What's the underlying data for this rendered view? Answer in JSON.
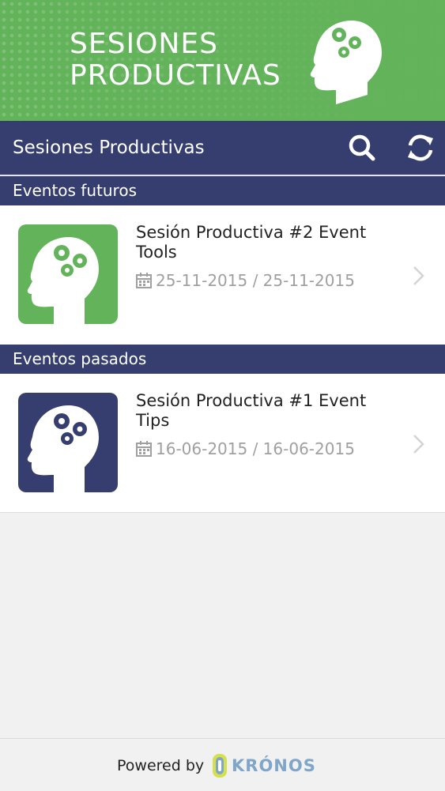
{
  "banner": {
    "line1": "SESIONES",
    "line2": "PRODUCTIVAS"
  },
  "toolbar": {
    "title": "Sesiones Productivas",
    "search_icon": "search-icon",
    "refresh_icon": "refresh-icon"
  },
  "sections": [
    {
      "header": "Eventos futuros",
      "events": [
        {
          "title": "Sesión Productiva #2 Event Tools",
          "dates": "25-11-2015 / 25-11-2015",
          "thumb_color": "#63b35a"
        }
      ]
    },
    {
      "header": "Eventos pasados",
      "events": [
        {
          "title": "Sesión Productiva #1 Event Tips",
          "dates": "16-06-2015 / 16-06-2015",
          "thumb_color": "#353e6e"
        }
      ]
    }
  ],
  "footer": {
    "powered_by": "Powered by",
    "brand": "KRÓNOS"
  },
  "colors": {
    "primary": "#353e6e",
    "accent": "#63b35a",
    "muted_text": "#a0a0a0"
  }
}
